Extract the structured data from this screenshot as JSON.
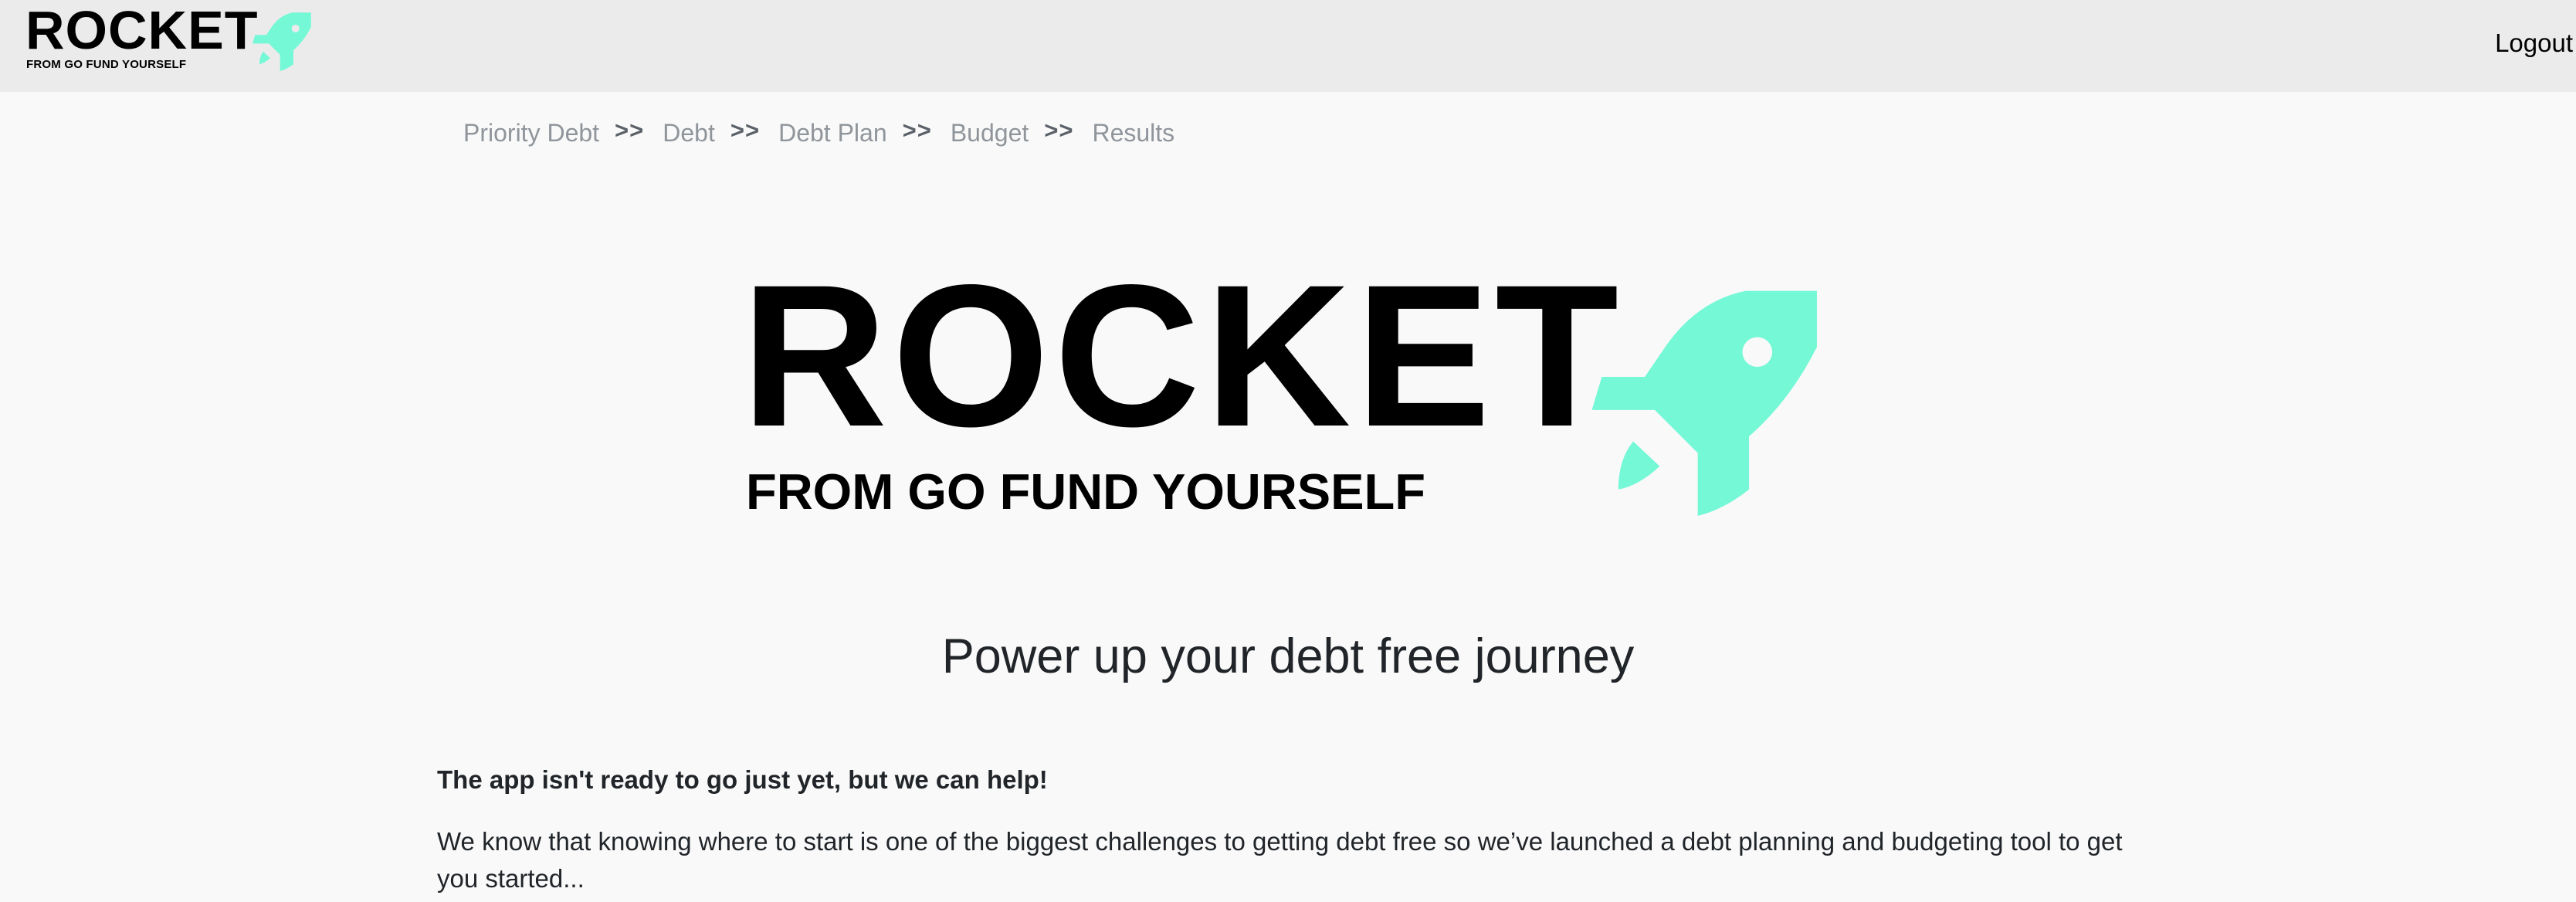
{
  "header": {
    "logo_word": "ROCKET",
    "logo_tagline": "FROM GO FUND YOURSELF",
    "logo_icon": "rocket-icon",
    "logout_label": "Logout"
  },
  "breadcrumb": {
    "items": [
      "Priority Debt",
      "Debt",
      "Debt Plan",
      "Budget",
      "Results"
    ],
    "separator": ">>"
  },
  "hero": {
    "logo_word": "ROCKET",
    "logo_tagline": "FROM GO FUND YOURSELF",
    "logo_icon": "rocket-icon"
  },
  "main": {
    "tagline": "Power up your debt free journey",
    "lead": "The app isn't ready to go just yet, but we can help!",
    "intro": "We know that knowing where to start is one of the biggest challenges to getting debt free so we’ve launched a debt planning and budgeting tool to get you started..."
  },
  "colors": {
    "accent": "#74f8d6",
    "header_bg": "#ebebeb",
    "page_bg": "#f9f9f9",
    "breadcrumb_text": "#8f959b"
  }
}
